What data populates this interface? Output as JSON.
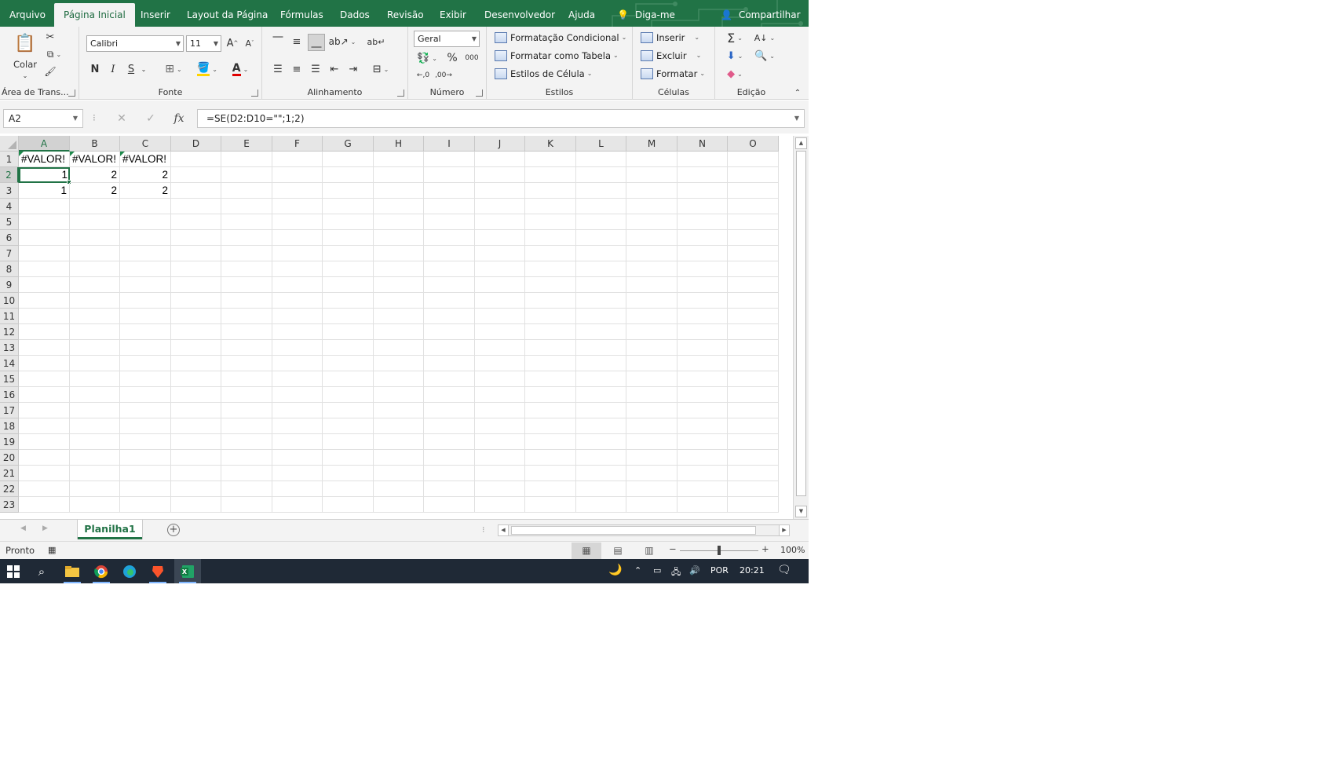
{
  "ribbon_tabs": [
    {
      "label": "Arquivo"
    },
    {
      "label": "Página Inicial",
      "active": true
    },
    {
      "label": "Inserir"
    },
    {
      "label": "Layout da Página"
    },
    {
      "label": "Fórmulas"
    },
    {
      "label": "Dados"
    },
    {
      "label": "Revisão"
    },
    {
      "label": "Exibir"
    },
    {
      "label": "Desenvolvedor"
    },
    {
      "label": "Ajuda"
    },
    {
      "label": "Diga-me"
    },
    {
      "label": "Compartilhar"
    }
  ],
  "groups": {
    "clipboard": {
      "label": "Área de Trans...",
      "paste_label": "Colar"
    },
    "font": {
      "label": "Fonte",
      "font_name": "Calibri",
      "font_size": "11",
      "bold": "N",
      "italic": "I",
      "underline": "S",
      "font_color_glyph": "A"
    },
    "alignment": {
      "label": "Alinhamento"
    },
    "number": {
      "label": "Número",
      "format": "Geral",
      "percent": "%",
      "thousands": "000"
    },
    "styles": {
      "label": "Estilos",
      "conditional": "Formatação Condicional",
      "as_table": "Formatar como Tabela",
      "cell_styles": "Estilos de Célula"
    },
    "cells": {
      "label": "Células",
      "insert": "Inserir",
      "delete": "Excluir",
      "format": "Formatar"
    },
    "editing": {
      "label": "Edição"
    }
  },
  "formula_bar": {
    "name_box": "A2",
    "fx": "fx",
    "formula": "=SE(D2:D10=\"\";1;2)"
  },
  "columns": [
    "A",
    "B",
    "C",
    "D",
    "E",
    "F",
    "G",
    "H",
    "I",
    "J",
    "K",
    "L",
    "M",
    "N",
    "O"
  ],
  "selected_column": "A",
  "rows": [
    "1",
    "2",
    "3",
    "4",
    "5",
    "6",
    "7",
    "8",
    "9",
    "10",
    "11",
    "12",
    "13",
    "14",
    "15",
    "16",
    "17",
    "18",
    "19",
    "20",
    "21",
    "22",
    "23"
  ],
  "selected_row": "2",
  "cells": {
    "A1": "#VALOR!",
    "B1": "#VALOR!",
    "C1": "#VALOR!",
    "A2": "1",
    "B2": "2",
    "C2": "2",
    "A3": "1",
    "B3": "2",
    "C3": "2"
  },
  "active_cell": "A2",
  "sheet_tab": "Planilha1",
  "status": {
    "text": "Pronto",
    "zoom": "100%"
  },
  "taskbar": {
    "language": "POR",
    "time": "20:21"
  },
  "colors": {
    "excel_green": "#217346",
    "taskbar": "#1f2936"
  }
}
